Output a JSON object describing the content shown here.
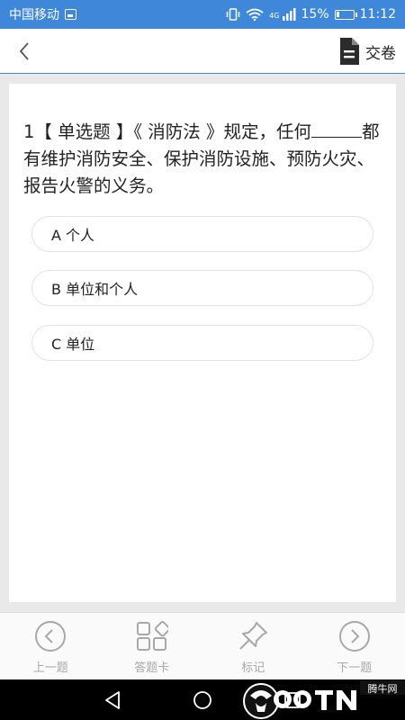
{
  "status_bar": {
    "carrier": "中国移动",
    "network": "4G",
    "battery": "15%",
    "battery_level": 0.15,
    "time": "11:12"
  },
  "header": {
    "submit_label": "交卷"
  },
  "question": {
    "number": "1",
    "type_label": "【 单选题 】",
    "text_before_blank": "《 消防法 》规定，任何",
    "text_after_blank": "都有维护消防安全、保护消防设施、预防火灾、报告火警的义务。",
    "options": [
      {
        "label": "A 个人"
      },
      {
        "label": "B 单位和个人"
      },
      {
        "label": "C 单位"
      }
    ]
  },
  "toolbar": {
    "prev_label": "上一题",
    "card_label": "答题卡",
    "mark_label": "标记",
    "next_label": "下一题"
  },
  "colors": {
    "status_bar": "#3f88d9",
    "icon_gray": "#a8a8a8",
    "option_border": "#e2e2e2"
  }
}
